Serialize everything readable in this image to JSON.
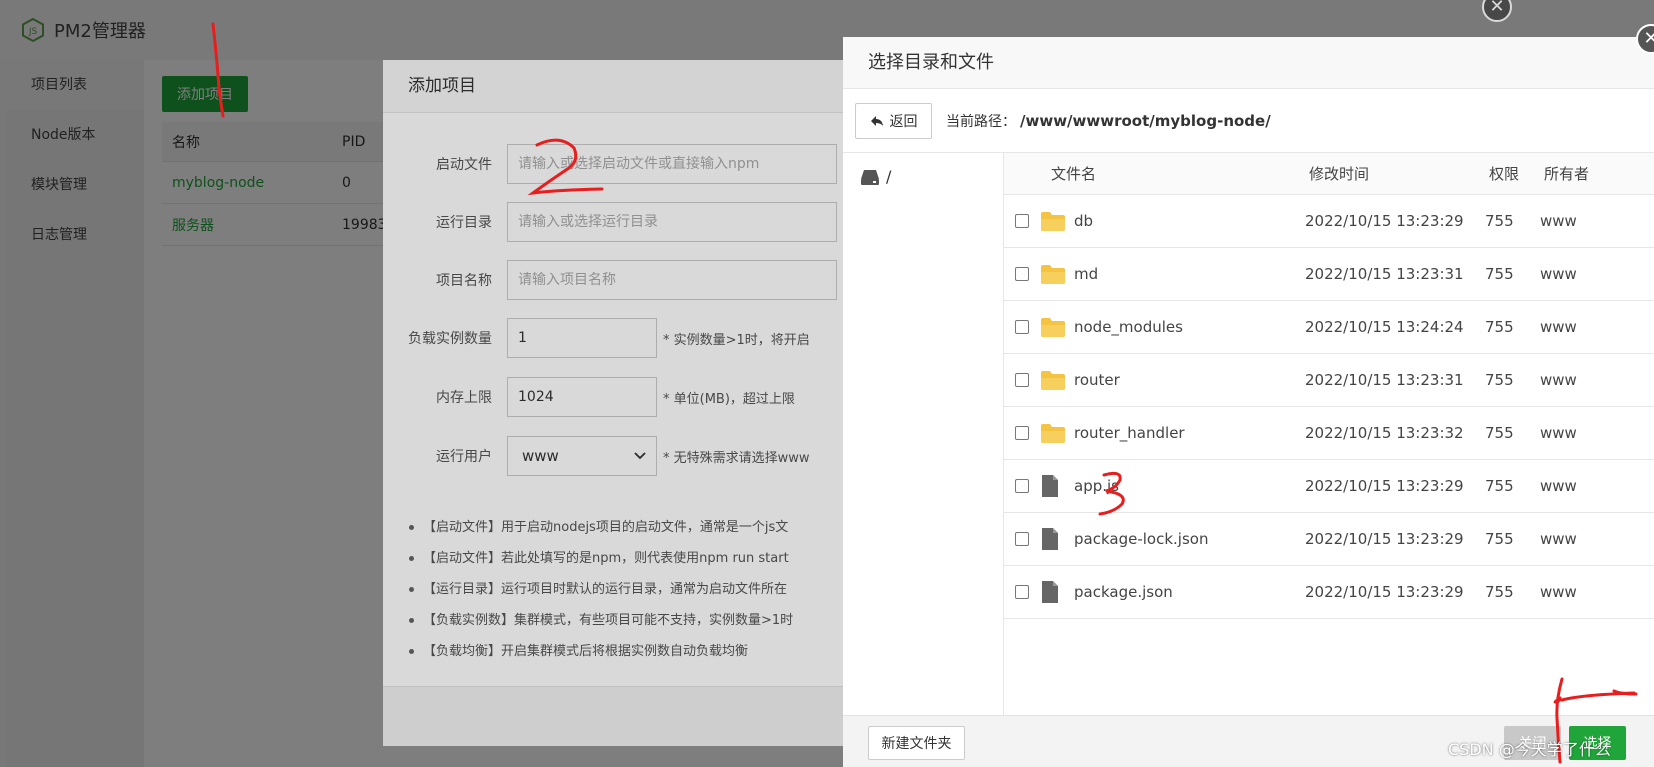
{
  "app": {
    "title": "PM2管理器"
  },
  "sidebar": {
    "items": [
      {
        "label": "项目列表"
      },
      {
        "label": "Node版本"
      },
      {
        "label": "模块管理"
      },
      {
        "label": "日志管理"
      }
    ]
  },
  "main": {
    "add_button": "添加项目",
    "table": {
      "headers": [
        "名称",
        "PID"
      ],
      "rows": [
        {
          "name": "myblog-node",
          "pid": "0"
        },
        {
          "name": "服务器",
          "pid": "19983"
        }
      ]
    }
  },
  "add_dialog": {
    "title": "添加项目",
    "fields": {
      "start_file": {
        "label": "启动文件",
        "placeholder": "请输入或选择启动文件或直接输入npm"
      },
      "run_dir": {
        "label": "运行目录",
        "placeholder": "请输入或选择运行目录"
      },
      "project_name": {
        "label": "项目名称",
        "placeholder": "请输入项目名称"
      },
      "instances": {
        "label": "负载实例数量",
        "value": "1",
        "hint": "* 实例数量>1时，将开启"
      },
      "memory": {
        "label": "内存上限",
        "value": "1024",
        "hint": "* 单位(MB)，超过上限"
      },
      "run_user": {
        "label": "运行用户",
        "value": "www",
        "hint": "* 无特殊需求请选择www"
      }
    },
    "notes": [
      "【启动文件】用于启动nodejs项目的启动文件，通常是一个js文",
      "【启动文件】若此处填写的是npm，则代表使用npm run start",
      "【运行目录】运行项目时默认的运行目录，通常为启动文件所在",
      "【负载实例数】集群模式，有些项目可能不支持，实例数量>1时",
      "【负载均衡】开启集群模式后将根据实例数自动负载均衡"
    ]
  },
  "file_dialog": {
    "title": "选择目录和文件",
    "back_label": "返回",
    "path_label": "当前路径：",
    "path_value": "/www/wwwroot/myblog-node/",
    "root": "/",
    "headers": {
      "name": "文件名",
      "time": "修改时间",
      "perm": "权限",
      "owner": "所有者"
    },
    "rows": [
      {
        "type": "folder",
        "name": "db",
        "time": "2022/10/15 13:23:29",
        "perm": "755",
        "owner": "www"
      },
      {
        "type": "folder",
        "name": "md",
        "time": "2022/10/15 13:23:31",
        "perm": "755",
        "owner": "www"
      },
      {
        "type": "folder",
        "name": "node_modules",
        "time": "2022/10/15 13:24:24",
        "perm": "755",
        "owner": "www"
      },
      {
        "type": "folder",
        "name": "router",
        "time": "2022/10/15 13:23:31",
        "perm": "755",
        "owner": "www"
      },
      {
        "type": "folder",
        "name": "router_handler",
        "time": "2022/10/15 13:23:32",
        "perm": "755",
        "owner": "www"
      },
      {
        "type": "file",
        "name": "app.js",
        "time": "2022/10/15 13:23:29",
        "perm": "755",
        "owner": "www"
      },
      {
        "type": "file",
        "name": "package-lock.json",
        "time": "2022/10/15 13:23:29",
        "perm": "755",
        "owner": "www"
      },
      {
        "type": "file",
        "name": "package.json",
        "time": "2022/10/15 13:23:29",
        "perm": "755",
        "owner": "www"
      }
    ],
    "new_folder_label": "新建文件夹",
    "cancel_label": "关闭",
    "select_label": "选择"
  },
  "watermark": "CSDN @今天学了什么",
  "colors": {
    "accent_green": "#20a53a",
    "folder_yellow": "#f5c342",
    "annotation_red": "#e81e1e"
  }
}
